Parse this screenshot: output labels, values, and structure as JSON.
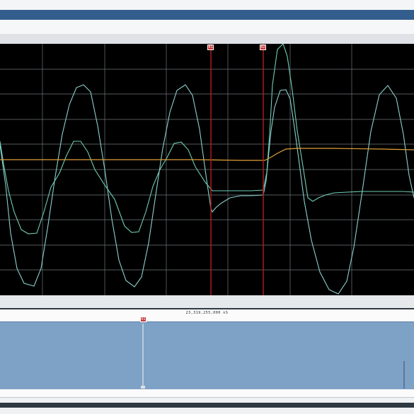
{
  "overview": {
    "time_label": "23,319,255,000 nS"
  },
  "markers": {
    "m1": {
      "label": "01"
    },
    "m2": {
      "label": "02"
    },
    "overview": {
      "label": "01"
    }
  },
  "colors": {
    "trace_a": "#8bd0cb",
    "trace_b": "#6fcdb4",
    "trace_c": "#e3a13a",
    "cursor": "#b51d1d",
    "grid": "#6f767c",
    "overview_fill": "#7ea1c6"
  },
  "chart_data": {
    "type": "line",
    "x_range": [
      0,
      585
    ],
    "y_range": [
      62,
      418
    ],
    "grid": true,
    "series": [
      {
        "points": [
          [
            0,
            205
          ],
          [
            8,
            262
          ],
          [
            15,
            330
          ],
          [
            24,
            380
          ],
          [
            34,
            401
          ],
          [
            48,
            405
          ],
          [
            58,
            380
          ],
          [
            68,
            318
          ],
          [
            78,
            250
          ],
          [
            88,
            190
          ],
          [
            98,
            148
          ],
          [
            108,
            124
          ],
          [
            118,
            120
          ],
          [
            128,
            130
          ],
          [
            138,
            178
          ],
          [
            148,
            240
          ],
          [
            158,
            310
          ],
          [
            168,
            368
          ],
          [
            178,
            397
          ],
          [
            190,
            406
          ],
          [
            200,
            392
          ],
          [
            210,
            344
          ],
          [
            220,
            276
          ],
          [
            230,
            210
          ],
          [
            240,
            159
          ],
          [
            250,
            128
          ],
          [
            262,
            120
          ],
          [
            272,
            135
          ],
          [
            282,
            183
          ],
          [
            292,
            255
          ],
          [
            298,
            295
          ],
          [
            300,
            300
          ],
          [
            305,
            294
          ],
          [
            312,
            288
          ],
          [
            325,
            280
          ],
          [
            340,
            277
          ],
          [
            355,
            277
          ],
          [
            372,
            276
          ],
          [
            376,
            256
          ],
          [
            379,
            225
          ],
          [
            383,
            185
          ],
          [
            388,
            152
          ],
          [
            396,
            128
          ],
          [
            404,
            127
          ],
          [
            410,
            140
          ],
          [
            416,
            180
          ],
          [
            423,
            232
          ],
          [
            430,
            285
          ],
          [
            440,
            340
          ],
          [
            452,
            385
          ],
          [
            465,
            410
          ],
          [
            478,
            416
          ],
          [
            490,
            398
          ],
          [
            500,
            350
          ],
          [
            512,
            270
          ],
          [
            524,
            186
          ],
          [
            536,
            134
          ],
          [
            548,
            121
          ],
          [
            560,
            139
          ],
          [
            570,
            190
          ],
          [
            578,
            248
          ],
          [
            585,
            280
          ]
        ]
      },
      {
        "points": [
          [
            0,
            200
          ],
          [
            5,
            232
          ],
          [
            12,
            270
          ],
          [
            20,
            300
          ],
          [
            30,
            325
          ],
          [
            40,
            331
          ],
          [
            52,
            330
          ],
          [
            62,
            300
          ],
          [
            72,
            265
          ],
          [
            84,
            245
          ],
          [
            94,
            220
          ],
          [
            104,
            200
          ],
          [
            114,
            200
          ],
          [
            124,
            215
          ],
          [
            134,
            240
          ],
          [
            148,
            262
          ],
          [
            162,
            282
          ],
          [
            176,
            320
          ],
          [
            186,
            329
          ],
          [
            196,
            328
          ],
          [
            206,
            300
          ],
          [
            216,
            264
          ],
          [
            226,
            240
          ],
          [
            236,
            223
          ],
          [
            246,
            203
          ],
          [
            256,
            201
          ],
          [
            266,
            212
          ],
          [
            276,
            236
          ],
          [
            290,
            258
          ],
          [
            300,
            270
          ],
          [
            310,
            270
          ],
          [
            330,
            270
          ],
          [
            355,
            270
          ],
          [
            372,
            269
          ],
          [
            377,
            244
          ],
          [
            381,
            190
          ],
          [
            385,
            120
          ],
          [
            392,
            70
          ],
          [
            400,
            62
          ],
          [
            406,
            80
          ],
          [
            413,
            128
          ],
          [
            420,
            185
          ],
          [
            428,
            235
          ],
          [
            435,
            280
          ],
          [
            442,
            285
          ],
          [
            450,
            280
          ],
          [
            460,
            276
          ],
          [
            472,
            273
          ],
          [
            490,
            272
          ],
          [
            510,
            271
          ],
          [
            530,
            271
          ],
          [
            550,
            271
          ],
          [
            570,
            271
          ],
          [
            585,
            272
          ]
        ]
      },
      {
        "points": [
          [
            0,
            226
          ],
          [
            60,
            226
          ],
          [
            100,
            226
          ],
          [
            160,
            226
          ],
          [
            220,
            226
          ],
          [
            280,
            226
          ],
          [
            340,
            227
          ],
          [
            374,
            227
          ],
          [
            382,
            223
          ],
          [
            392,
            217
          ],
          [
            404,
            211
          ],
          [
            420,
            210
          ],
          [
            470,
            210
          ],
          [
            540,
            211
          ],
          [
            585,
            212
          ]
        ]
      }
    ]
  }
}
